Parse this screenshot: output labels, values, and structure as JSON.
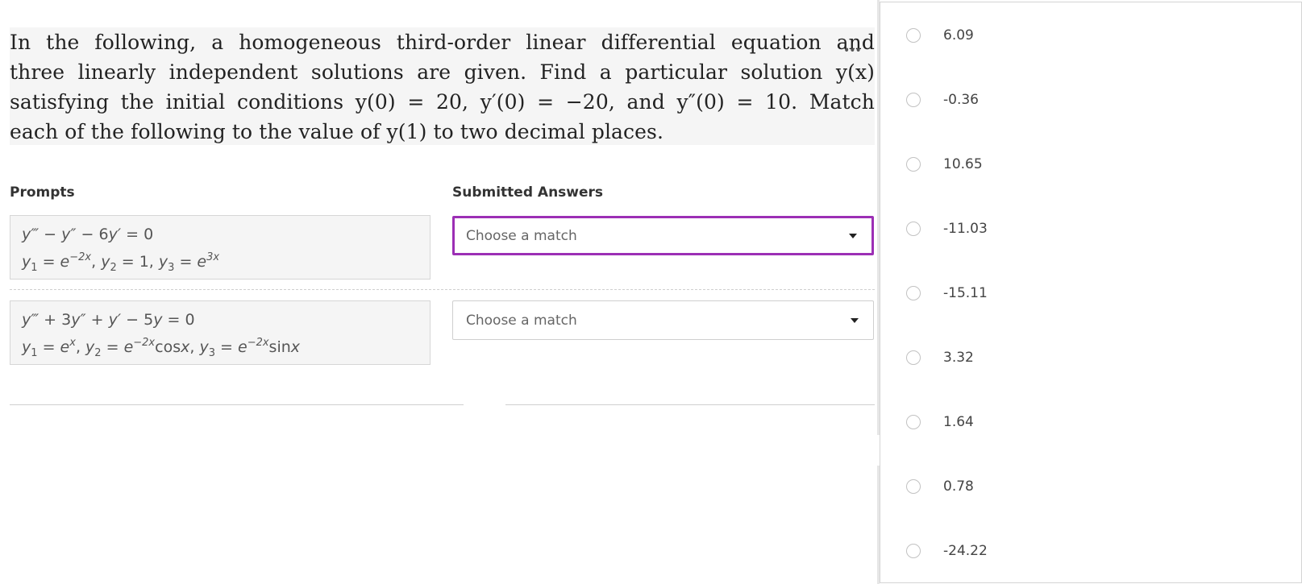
{
  "question": {
    "lines": [
      "In the following, a homogeneous third-order linear differential equation and",
      "three linearly independent solutions are given. Find a particular solution y(x)",
      "satisfying the initial conditions y(0) = 20, y′(0) = −20, and y″(0) = 10. Match",
      "each of the following to the value of y(1) to two decimal places."
    ],
    "more_icon": "ellipsis-icon"
  },
  "headers": {
    "prompts": "Prompts",
    "answers": "Submitted Answers"
  },
  "prompts": [
    {
      "equation": [
        "y‴",
        " − ",
        "y″",
        " − 6",
        "y′",
        " = 0"
      ],
      "solutions": [
        "y",
        "1",
        " = ",
        "e",
        "−2x",
        ", ",
        "y",
        "2",
        " = 1, ",
        "y",
        "3",
        " = ",
        "e",
        "3x"
      ]
    },
    {
      "equation": [
        "y‴",
        " + 3",
        "y″",
        " + ",
        "y′",
        " − 5",
        "y",
        " = 0"
      ],
      "solutions": [
        "y",
        "1",
        " = ",
        "e",
        "x",
        ", ",
        "y",
        "2",
        " = ",
        "e",
        "−2x",
        "cos",
        "x",
        ", ",
        "y",
        "3",
        " = ",
        "e",
        "−2x",
        "sin",
        "x"
      ]
    }
  ],
  "answers": [
    {
      "placeholder": "Choose a match",
      "icon": "caret-down-icon"
    },
    {
      "placeholder": "Choose a match",
      "icon": "caret-down-icon"
    }
  ],
  "dropdown_options": [
    "6.09",
    "-0.36",
    "10.65",
    "-11.03",
    "-15.11",
    "3.32",
    "1.64",
    "0.78",
    "-24.22"
  ],
  "colors": {
    "focus_border": "#9c2fb5",
    "prompt_bg": "#f5f5f5",
    "question_bg": "#f5f5f5"
  }
}
